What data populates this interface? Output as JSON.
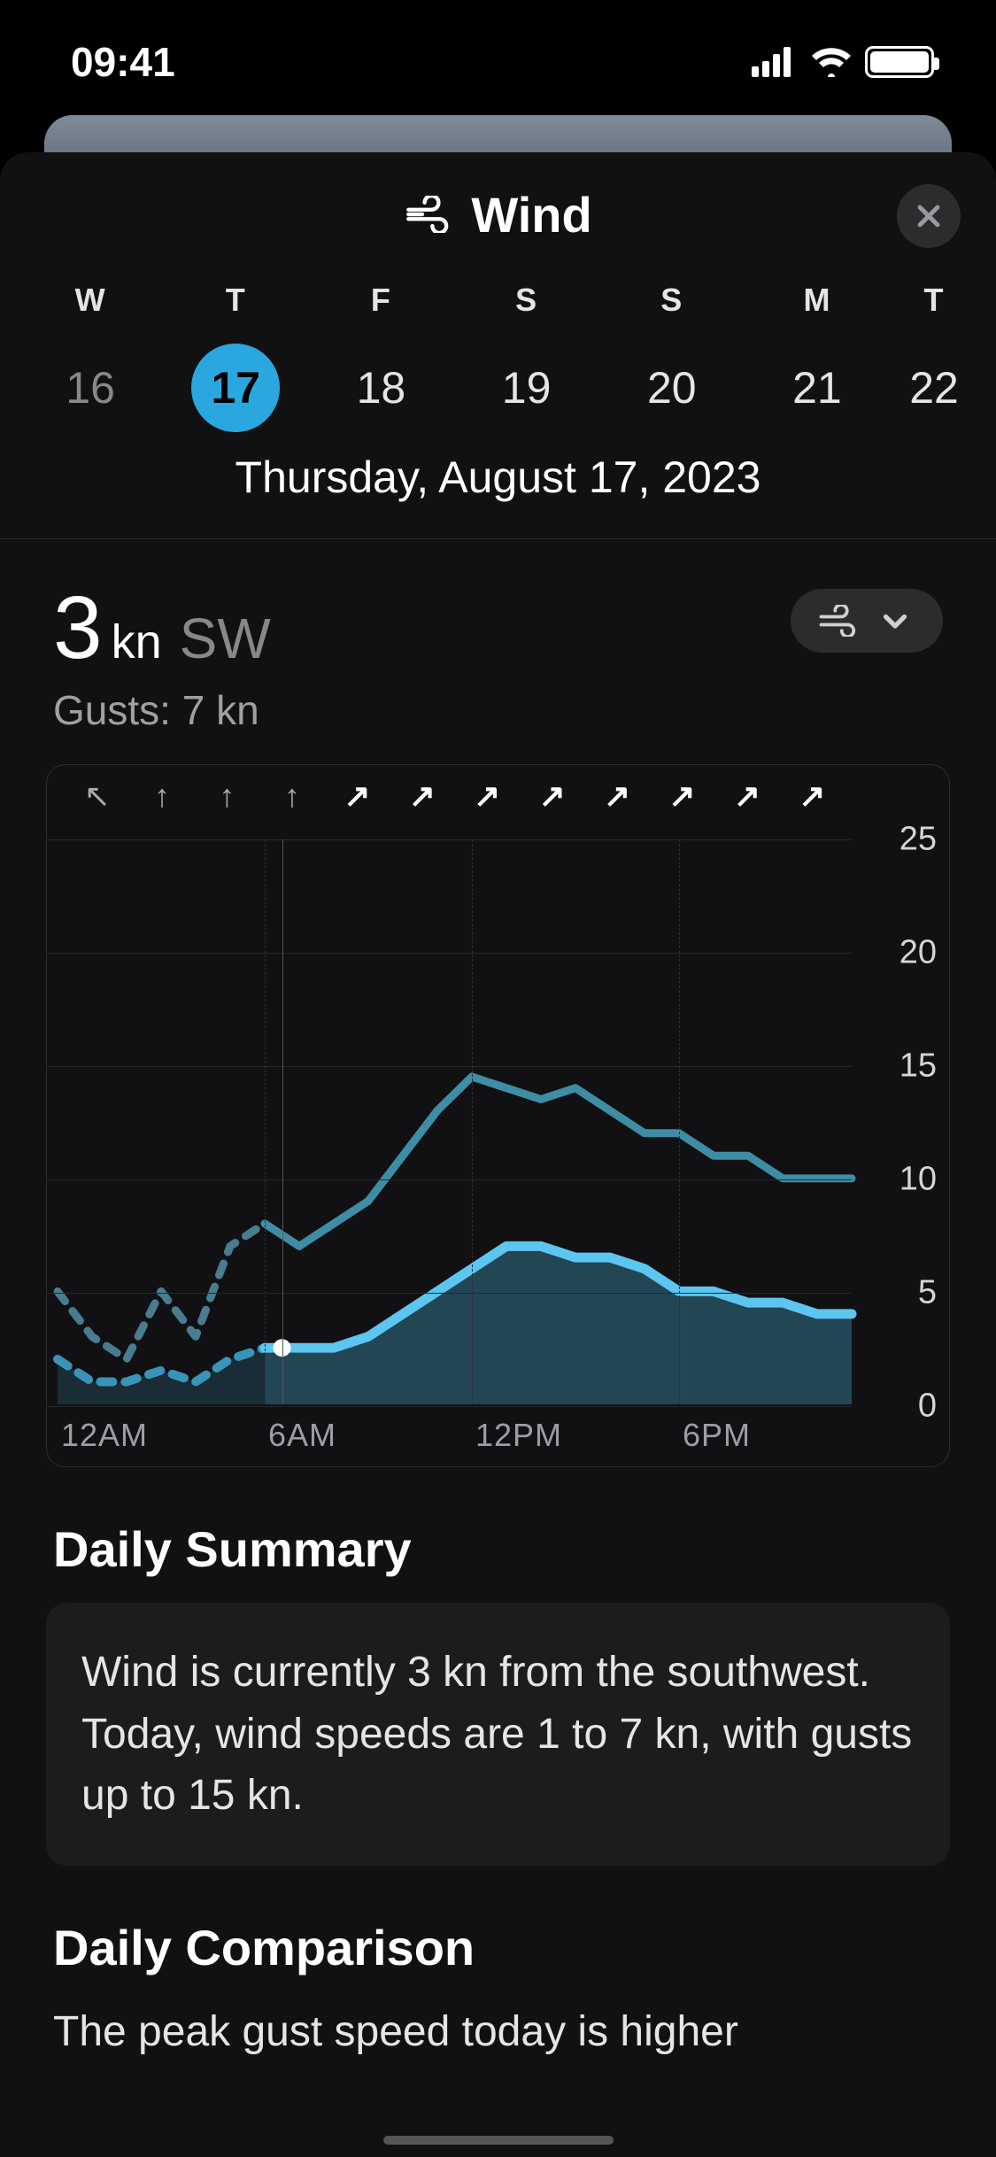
{
  "status": {
    "time": "09:41"
  },
  "header": {
    "title": "Wind"
  },
  "days": [
    {
      "weekday": "W",
      "num": "16",
      "dim": true
    },
    {
      "weekday": "T",
      "num": "17",
      "selected": true
    },
    {
      "weekday": "F",
      "num": "18"
    },
    {
      "weekday": "S",
      "num": "19"
    },
    {
      "weekday": "S",
      "num": "20"
    },
    {
      "weekday": "M",
      "num": "21"
    },
    {
      "weekday": "T",
      "num": "22"
    }
  ],
  "full_date": "Thursday, August 17, 2023",
  "current": {
    "speed": "3",
    "unit": "kn",
    "direction": "SW",
    "gusts_line": "Gusts: 7 kn"
  },
  "yticks": [
    "25",
    "20",
    "15",
    "10",
    "5",
    "0"
  ],
  "xticks": [
    "12AM",
    "6AM",
    "12PM",
    "6PM"
  ],
  "section1_title": "Daily Summary",
  "summary_text": "Wind is currently 3 kn from the southwest. Today, wind speeds are 1 to 7 kn, with gusts up to 15 kn.",
  "section2_title": "Daily Comparison",
  "comparison_partial": "The peak gust speed today is higher",
  "chart_data": {
    "type": "line",
    "title": "Wind",
    "xlabel": "",
    "ylabel": "kn",
    "ylim": [
      0,
      25
    ],
    "now_hour": 6.5,
    "x_hours": [
      0,
      1,
      2,
      3,
      4,
      5,
      6,
      7,
      8,
      9,
      10,
      11,
      12,
      13,
      14,
      15,
      16,
      17,
      18,
      19,
      20,
      21,
      22,
      23
    ],
    "series": [
      {
        "name": "wind_speed",
        "values": [
          2,
          1,
          1,
          1.5,
          1,
          2,
          2.5,
          2.5,
          2.5,
          3,
          4,
          5,
          6,
          7,
          7,
          6.5,
          6.5,
          6,
          5,
          5,
          4.5,
          4.5,
          4,
          4
        ],
        "observed_until_idx": 6
      },
      {
        "name": "gusts",
        "values": [
          5,
          3,
          2,
          5,
          3,
          7,
          8,
          7,
          8,
          9,
          11,
          13,
          14.5,
          14,
          13.5,
          14,
          13,
          12,
          12,
          11,
          11,
          10,
          10,
          10
        ],
        "observed_until_idx": 6
      }
    ],
    "wind_direction_arrows": [
      {
        "hour": 0,
        "glyph": "↖"
      },
      {
        "hour": 2,
        "glyph": "↑"
      },
      {
        "hour": 4,
        "glyph": "↑"
      },
      {
        "hour": 6,
        "glyph": "↑"
      },
      {
        "hour": 8,
        "glyph": "↗"
      },
      {
        "hour": 10,
        "glyph": "↗"
      },
      {
        "hour": 12,
        "glyph": "↗"
      },
      {
        "hour": 14,
        "glyph": "↗"
      },
      {
        "hour": 16,
        "glyph": "↗"
      },
      {
        "hour": 18,
        "glyph": "↗"
      },
      {
        "hour": 20,
        "glyph": "↗"
      },
      {
        "hour": 22,
        "glyph": "↗"
      }
    ]
  }
}
